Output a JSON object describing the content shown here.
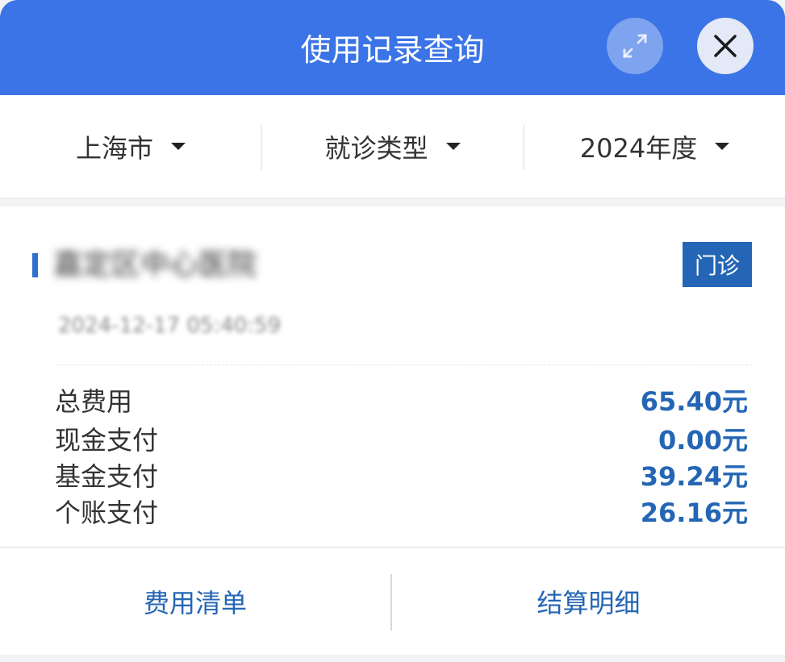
{
  "header": {
    "title": "使用记录查询",
    "expand_icon": "expand-icon",
    "close_icon": "close-icon",
    "accent_color": "#3b74e6"
  },
  "filters": [
    {
      "label": "上海市"
    },
    {
      "label": "就诊类型"
    },
    {
      "label": "2024年度"
    }
  ],
  "record": {
    "hospital_name": "嘉定区中心医院",
    "visit_type": "门诊",
    "visit_time": "2024-12-17 05:40:59",
    "items": [
      {
        "label": "总费用",
        "value": "65.40元"
      },
      {
        "label": "现金支付",
        "value": "0.00元"
      },
      {
        "label": "基金支付",
        "value": "39.24元"
      },
      {
        "label": "个账支付",
        "value": "26.16元"
      }
    ],
    "value_color": "#2466b5"
  },
  "actions": {
    "fee_list": "费用清单",
    "settlement_detail": "结算明细"
  }
}
